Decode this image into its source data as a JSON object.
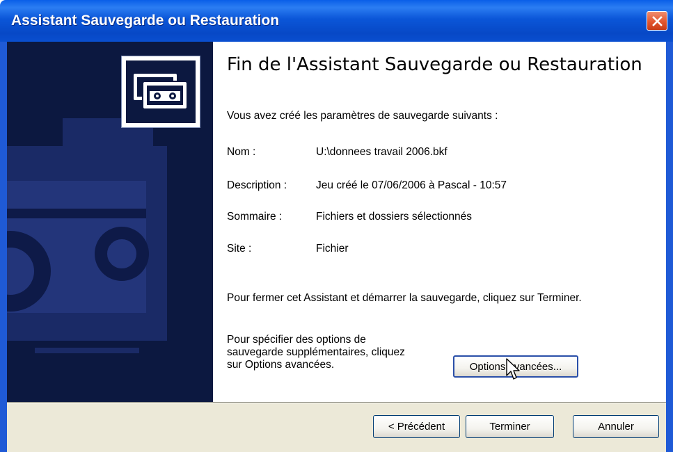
{
  "window": {
    "title": "Assistant Sauvegarde ou Restauration",
    "close_icon": "close-icon"
  },
  "header": {
    "title": "Fin de l'Assistant Sauvegarde ou Restauration"
  },
  "intro": "Vous avez créé les paramètres de sauvegarde suivants :",
  "settings": [
    {
      "label": "Nom :",
      "value": "U:\\donnees travail 2006.bkf"
    },
    {
      "label": "Description :",
      "value": "Jeu créé le 07/06/2006 à Pascal - 10:57"
    },
    {
      "label": "Sommaire :",
      "value": "Fichiers et dossiers sélectionnés"
    },
    {
      "label": "Site :",
      "value": "Fichier"
    }
  ],
  "finish_text": "Pour fermer cet Assistant et démarrer la sauvegarde, cliquez sur Terminer.",
  "advanced_text": "Pour spécifier des options de sauvegarde supplémentaires, cliquez sur Options avancées.",
  "buttons": {
    "advanced": "Options avancées...",
    "back": "< Précédent",
    "finish": "Terminer",
    "cancel": "Annuler"
  },
  "colors": {
    "titlebar": "#0a4fd0",
    "sidebar": "#0c1840",
    "footer": "#ece9d8",
    "close": "#e2562f"
  }
}
